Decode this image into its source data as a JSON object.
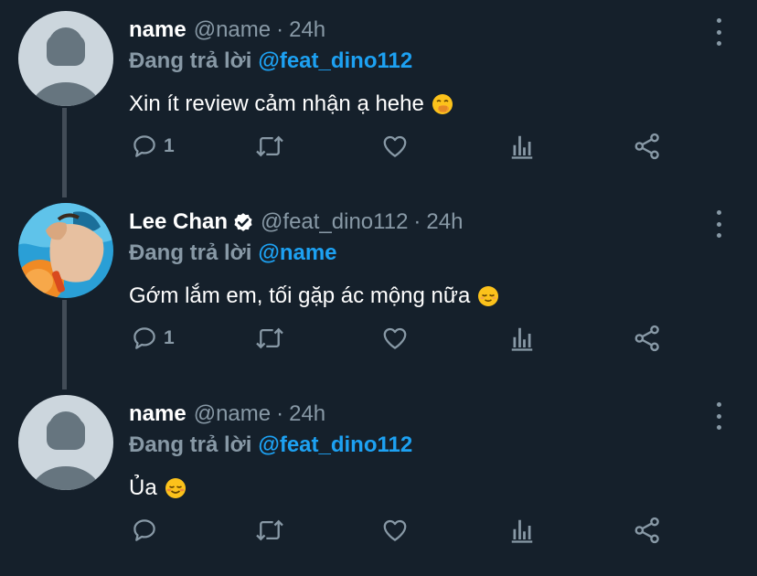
{
  "tweets": [
    {
      "display_name": "name",
      "handle": "@name",
      "separator": "·",
      "time": "24h",
      "verified": false,
      "avatar": "default-avatar",
      "replying_prefix": "Đang trả lời",
      "replying_to": "@feat_dino112",
      "text": "Xin ít review cảm nhận ạ hehe",
      "emoji": "hand-over-mouth-emoji",
      "reply_count": "1"
    },
    {
      "display_name": "Lee Chan",
      "handle": "@feat_dino112",
      "separator": "·",
      "time": "24h",
      "verified": true,
      "avatar": "photo-avatar",
      "replying_prefix": "Đang trả lời",
      "replying_to": "@name",
      "text": "Gớm lắm em, tối gặp ác mộng nữa",
      "emoji": "relieved-face-emoji",
      "reply_count": "1"
    },
    {
      "display_name": "name",
      "handle": "@name",
      "separator": "·",
      "time": "24h",
      "verified": false,
      "avatar": "default-avatar",
      "replying_prefix": "Đang trả lời",
      "replying_to": "@feat_dino112",
      "text": "Ủa",
      "emoji": "smiling-face-emoji",
      "reply_count": ""
    }
  ],
  "colors": {
    "background": "#15202b",
    "text": "#ffffff",
    "secondary": "#8899a6",
    "link": "#1da1f2",
    "thread_line": "#424c57"
  },
  "icons": [
    "reply-icon",
    "retweet-icon",
    "like-icon",
    "analytics-icon",
    "share-icon",
    "more-icon",
    "verified-badge-icon"
  ]
}
